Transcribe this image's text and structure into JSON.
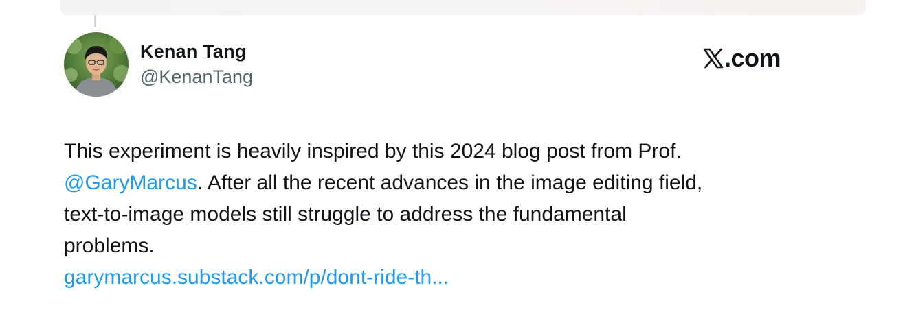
{
  "tweet": {
    "author": {
      "name": "Kenan Tang",
      "handle": "@KenanTang",
      "avatar_icon": "person-photo-avatar"
    },
    "source_label": ".com",
    "source_icon": "x-logo-icon",
    "body": {
      "line1": "This experiment is heavily inspired by this 2024 blog post from Prof.",
      "mention": "@GaryMarcus",
      "line2_rest": ". After all the recent advances in the image editing field,",
      "line3": "text-to-image models still struggle to address the fundamental",
      "line4": "problems.",
      "link": "garymarcus.substack.com/p/dont-ride-th..."
    },
    "colors": {
      "link": "#1d9bf0",
      "text": "#0f1419",
      "secondary": "#536471"
    }
  }
}
